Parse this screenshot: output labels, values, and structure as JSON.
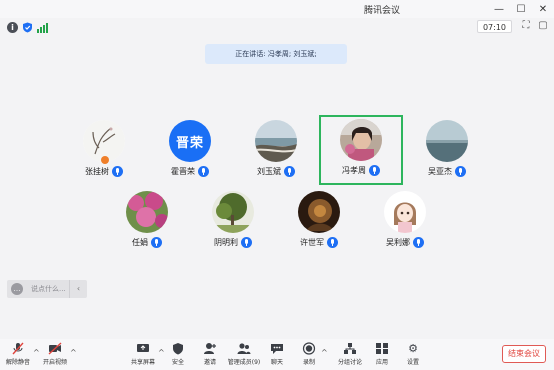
{
  "window": {
    "title": "腾讯会议"
  },
  "status": {
    "timer": "07:10"
  },
  "speaking": {
    "text": "正在讲话: 冯孝周; 刘玉斌;"
  },
  "participants": [
    {
      "name": "张挂树"
    },
    {
      "name": "霍晋荣",
      "avatar_text": "晋荣"
    },
    {
      "name": "刘玉斌"
    },
    {
      "name": "冯孝周"
    },
    {
      "name": "吴亚杰"
    },
    {
      "name": "任娟"
    },
    {
      "name": "阴明利"
    },
    {
      "name": "许世军"
    },
    {
      "name": "吴利娜"
    }
  ],
  "chat": {
    "placeholder": "说点什么..."
  },
  "toolbar": {
    "unmute": "解除静音",
    "video": "开启视频",
    "share": "共享屏幕",
    "security": "安全",
    "invite": "邀请",
    "members": "管理成员(9)",
    "chat": "聊天",
    "record": "录制",
    "breakout": "分组讨论",
    "apps": "应用",
    "settings": "设置",
    "end": "结束会议"
  },
  "colors": {
    "accent": "#1e6ff4",
    "active_border": "#2db55d",
    "end": "#e0443d"
  }
}
